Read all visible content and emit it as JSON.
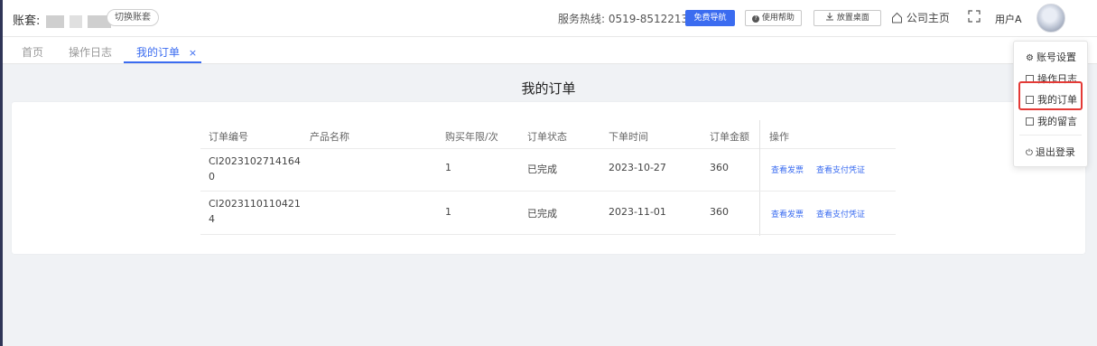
{
  "header": {
    "account_label": "账套:",
    "switch_account": "切换账套",
    "hotline": "服务热线:  0519-85122137",
    "free_nav": "免费导航",
    "help": "使用帮助",
    "desktop": "放置桌面",
    "company_home": "公司主页",
    "user_name": "用户A"
  },
  "tabs": [
    {
      "label": "首页"
    },
    {
      "label": "操作日志"
    },
    {
      "label": "我的订单",
      "close": "×"
    }
  ],
  "page_title": "我的订单",
  "table": {
    "columns": [
      "订单编号",
      "产品名称",
      "购买年限/次",
      "订单状态",
      "下单时间",
      "订单金额",
      "操作"
    ],
    "rows": [
      {
        "order_no": "CI20231027141640",
        "product": "",
        "years": "1",
        "status": "已完成",
        "time": "2023-10-27",
        "amount": "360",
        "action_invoice": "查看发票",
        "action_payment": "查看支付凭证"
      },
      {
        "order_no": "CI20231101104214",
        "product": "",
        "years": "1",
        "status": "已完成",
        "time": "2023-11-01",
        "amount": "360",
        "action_invoice": "查看发票",
        "action_payment": "查看支付凭证"
      }
    ]
  },
  "dropdown": {
    "items": [
      "账号设置",
      "操作日志",
      "我的订单",
      "我的留言",
      "退出登录"
    ]
  },
  "colors": {
    "accent": "#3b6cf0",
    "highlight": "#e43a36"
  }
}
